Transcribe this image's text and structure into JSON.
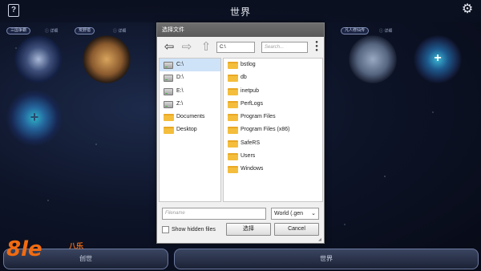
{
  "header": {
    "title": "世界",
    "help_icon": "question-book-icon",
    "settings_icon": "gear-icon"
  },
  "world_cards": [
    {
      "tag": "三国争霸",
      "detail": "ⓘ 详细"
    },
    {
      "tag": "荒野猎",
      "detail": "ⓘ 详细"
    },
    {
      "tag": "凡人修仙传",
      "detail": "ⓘ 详细"
    }
  ],
  "add_icon_label": "+",
  "bottom_bar": {
    "left_label": "创世",
    "right_label": "世界"
  },
  "watermark": {
    "big": "8le",
    "small": "八乐"
  },
  "dialog": {
    "title": "选择文件",
    "path_value": "C:\\",
    "search_placeholder": "Search...",
    "more_icon": "vertical-dots-icon",
    "drives": [
      "C:\\",
      "D:\\",
      "E:\\",
      "Z:\\"
    ],
    "shortcuts": [
      "Documents",
      "Desktop"
    ],
    "selected_drive": "C:\\",
    "folders": [
      "bstlog",
      "db",
      "inetpub",
      "PerfLogs",
      "Program Files",
      "Program Files (x86)",
      "SafeRS",
      "Users",
      "Windows"
    ],
    "filename_placeholder": "Filename",
    "filter_value": "World (.gen",
    "show_hidden_label": "Show hidden files",
    "show_hidden_checked": false,
    "select_label": "选择",
    "cancel_label": "Cancel"
  }
}
